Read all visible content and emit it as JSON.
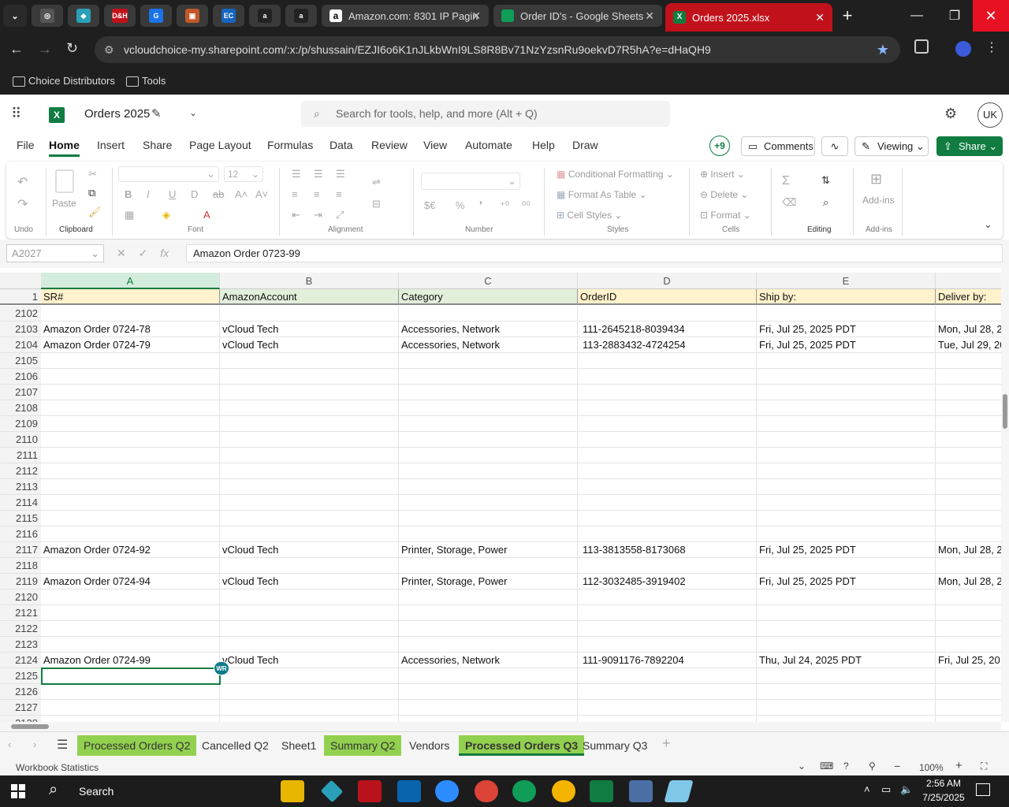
{
  "browser": {
    "pinned_tabs": [
      {
        "name": "chrome-tab-1",
        "glyph": "◎",
        "color": "#555"
      },
      {
        "name": "chrome-tab-2",
        "glyph": "◆",
        "color": "#2aa0b8"
      },
      {
        "name": "chrome-tab-3",
        "glyph": "D&H",
        "color": "#c1121b"
      },
      {
        "name": "chrome-tab-4",
        "glyph": "G",
        "color": "#1a73e8"
      },
      {
        "name": "chrome-tab-5",
        "glyph": "▣",
        "color": "#c0582a"
      },
      {
        "name": "chrome-tab-6",
        "glyph": "EC",
        "color": "#1565c0"
      },
      {
        "name": "chrome-tab-7",
        "glyph": "a",
        "color": "#222"
      },
      {
        "name": "chrome-tab-8",
        "glyph": "a",
        "color": "#222"
      }
    ],
    "tabs": [
      {
        "title": "Amazon.com: 8301 IP Pagin"
      },
      {
        "title": "Order ID's - Google Sheets"
      },
      {
        "title": "Orders 2025.xlsx"
      }
    ],
    "url": "vcloudchoice-my.sharepoint.com/:x:/p/shussain/EZJI6o6K1nJLkbWnI9LS8R8Bv71NzYzsnRu9oekvD7R5hA?e=dHaQH9",
    "bookmarks": [
      "Choice Distributors",
      "Tools"
    ]
  },
  "excel": {
    "doc_title": "Orders 2025",
    "search_placeholder": "Search for tools, help, and more (Alt + Q)",
    "user_initials": "UK",
    "menu": [
      "File",
      "Home",
      "Insert",
      "Share",
      "Page Layout",
      "Formulas",
      "Data",
      "Review",
      "View",
      "Automate",
      "Help",
      "Draw"
    ],
    "active_menu": "Home",
    "collaborators": "+9",
    "comments_label": "Comments",
    "viewing_label": "Viewing",
    "share_label": "Share",
    "ribbon": {
      "undo_group": "Undo",
      "paste": "Paste",
      "clipboard": "Clipboard",
      "font_size": "12",
      "font": "Font",
      "alignment": "Alignment",
      "number": "Number",
      "conditional": "Conditional Formatting",
      "format_table": "Format As Table",
      "cell_styles": "Cell Styles",
      "styles": "Styles",
      "insert": "Insert",
      "delete": "Delete",
      "format": "Format",
      "cells": "Cells",
      "editing": "Editing",
      "addins": "Add-ins",
      "addins_group": "Add-ins"
    },
    "name_box": "A2027",
    "formula": "Amazon Order 0723-99",
    "columns": [
      {
        "letter": "A",
        "header": "SR#"
      },
      {
        "letter": "B",
        "header": "AmazonAccount"
      },
      {
        "letter": "C",
        "header": "Category"
      },
      {
        "letter": "D",
        "header": "OrderID"
      },
      {
        "letter": "E",
        "header": "Ship by:"
      },
      {
        "letter": "",
        "header": "Deliver by:"
      }
    ],
    "header_row_num": "1",
    "rows": [
      {
        "n": "2102",
        "c": [
          "",
          "",
          "",
          "",
          "",
          ""
        ]
      },
      {
        "n": "2103",
        "c": [
          "Amazon Order 0724-78",
          "vCloud Tech",
          "Accessories, Network",
          "111-2645218-8039434",
          "Fri, Jul 25, 2025 PDT",
          "Mon, Jul 28, 2"
        ]
      },
      {
        "n": "2104",
        "c": [
          "Amazon Order 0724-79",
          "vCloud Tech",
          "Accessories, Network",
          "113-2883432-4724254",
          "Fri, Jul 25, 2025 PDT",
          "Tue, Jul 29, 20"
        ]
      },
      {
        "n": "2105",
        "c": [
          "",
          "",
          "",
          "",
          "",
          ""
        ]
      },
      {
        "n": "2106",
        "c": [
          "",
          "",
          "",
          "",
          "",
          ""
        ]
      },
      {
        "n": "2107",
        "c": [
          "",
          "",
          "",
          "",
          "",
          ""
        ]
      },
      {
        "n": "2108",
        "c": [
          "",
          "",
          "",
          "",
          "",
          ""
        ]
      },
      {
        "n": "2109",
        "c": [
          "",
          "",
          "",
          "",
          "",
          ""
        ]
      },
      {
        "n": "2110",
        "c": [
          "",
          "",
          "",
          "",
          "",
          ""
        ]
      },
      {
        "n": "2111",
        "c": [
          "",
          "",
          "",
          "",
          "",
          ""
        ]
      },
      {
        "n": "2112",
        "c": [
          "",
          "",
          "",
          "",
          "",
          ""
        ]
      },
      {
        "n": "2113",
        "c": [
          "",
          "",
          "",
          "",
          "",
          ""
        ]
      },
      {
        "n": "2114",
        "c": [
          "",
          "",
          "",
          "",
          "",
          ""
        ]
      },
      {
        "n": "2115",
        "c": [
          "",
          "",
          "",
          "",
          "",
          ""
        ]
      },
      {
        "n": "2116",
        "c": [
          "",
          "",
          "",
          "",
          "",
          ""
        ]
      },
      {
        "n": "2117",
        "c": [
          "Amazon Order 0724-92",
          "vCloud Tech",
          "Printer, Storage, Power",
          "113-3813558-8173068",
          "Fri, Jul 25, 2025 PDT",
          "Mon, Jul 28, 2"
        ]
      },
      {
        "n": "2118",
        "c": [
          "",
          "",
          "",
          "",
          "",
          ""
        ]
      },
      {
        "n": "2119",
        "c": [
          "Amazon Order 0724-94",
          "vCloud Tech",
          "Printer, Storage, Power",
          "112-3032485-3919402",
          "Fri, Jul 25, 2025 PDT",
          "Mon, Jul 28, 2"
        ]
      },
      {
        "n": "2120",
        "c": [
          "",
          "",
          "",
          "",
          "",
          ""
        ]
      },
      {
        "n": "2121",
        "c": [
          "",
          "",
          "",
          "",
          "",
          ""
        ]
      },
      {
        "n": "2122",
        "c": [
          "",
          "",
          "",
          "",
          "",
          ""
        ]
      },
      {
        "n": "2123",
        "c": [
          "",
          "",
          "",
          "",
          "",
          ""
        ]
      },
      {
        "n": "2124",
        "c": [
          "Amazon Order 0724-99",
          "vCloud Tech",
          "Accessories, Network",
          "111-9091176-7892204",
          "Thu, Jul 24, 2025 PDT",
          "Fri, Jul 25, 20"
        ]
      },
      {
        "n": "2125",
        "c": [
          "",
          "",
          "",
          "",
          "",
          ""
        ]
      },
      {
        "n": "2126",
        "c": [
          "",
          "",
          "",
          "",
          "",
          ""
        ]
      },
      {
        "n": "2127",
        "c": [
          "",
          "",
          "",
          "",
          "",
          ""
        ]
      },
      {
        "n": "2128",
        "c": [
          "",
          "",
          "",
          "",
          "",
          ""
        ]
      }
    ],
    "presence_badge": "WR",
    "sheets": [
      {
        "label": "Processed Orders Q2",
        "green": true,
        "active": false
      },
      {
        "label": "Cancelled Q2",
        "green": false,
        "active": false
      },
      {
        "label": "Sheet1",
        "green": false,
        "active": false
      },
      {
        "label": "Summary Q2",
        "green": true,
        "active": false
      },
      {
        "label": "Vendors",
        "green": false,
        "active": false
      },
      {
        "label": "Processed Orders Q3",
        "green": true,
        "active": true
      },
      {
        "label": "Summary Q3",
        "green": false,
        "active": false
      }
    ],
    "status_left": "Workbook Statistics",
    "zoom": "100%"
  },
  "taskbar": {
    "search_label": "Search",
    "time": "2:56 AM",
    "date": "7/25/2025"
  },
  "colors": {
    "excel_green": "#107c41",
    "tab_red": "#c1121b",
    "header_yellow": "#fff2cc",
    "header_green": "#e2efda",
    "sheet_green": "#92d050"
  }
}
